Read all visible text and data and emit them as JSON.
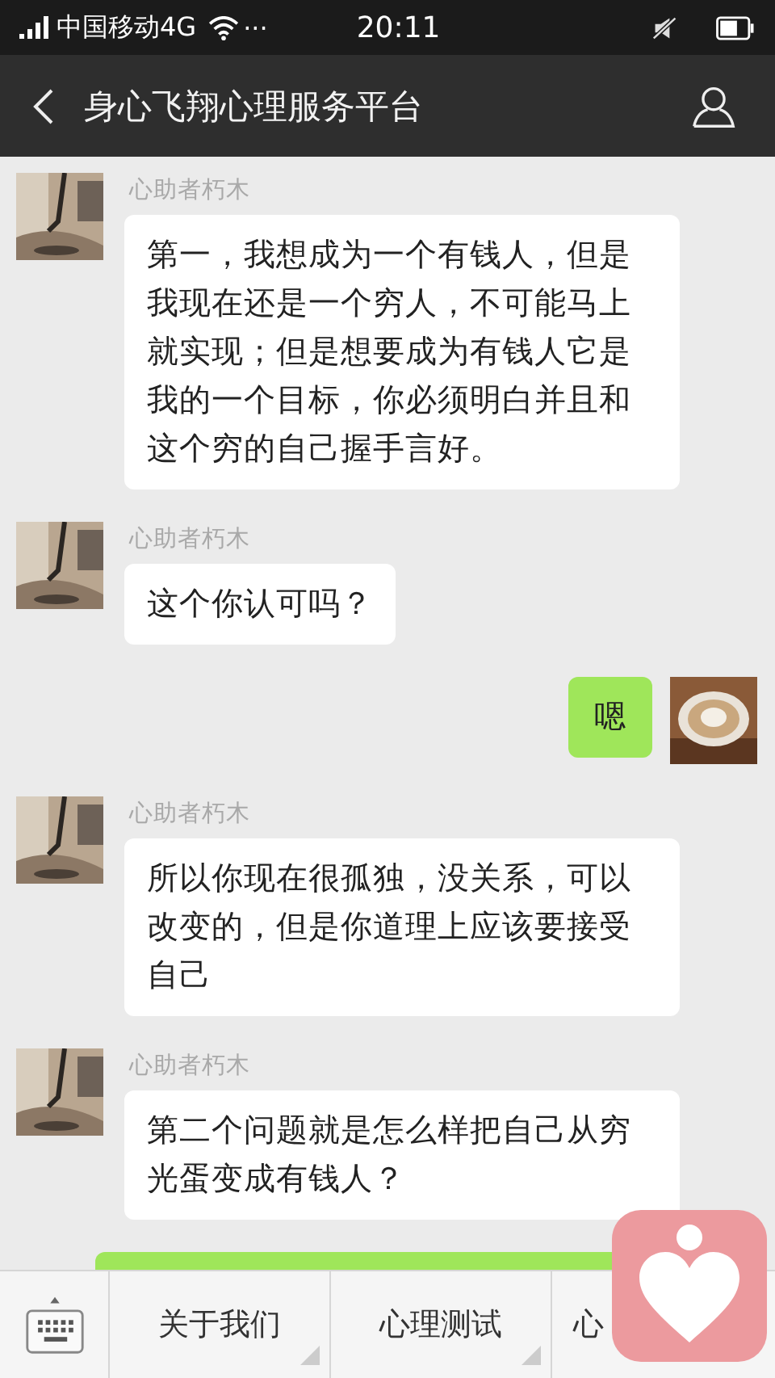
{
  "status_bar": {
    "carrier": "中国移动4G",
    "more": "···",
    "time": "20:11"
  },
  "nav": {
    "title": "身心飞翔心理服务平台"
  },
  "messages": [
    {
      "kind": "received",
      "sender": "心助者朽木",
      "text": "第一，我想成为一个有钱人，但是我现在还是一个穷人，不可能马上就实现；但是想要成为有钱人它是我的一个目标，你必须明白并且和这个穷的自己握手言好。"
    },
    {
      "kind": "received",
      "sender": "心助者朽木",
      "text": "这个你认可吗？"
    },
    {
      "kind": "sent",
      "text": "嗯"
    },
    {
      "kind": "received",
      "sender": "心助者朽木",
      "text": "所以你现在很孤独，没关系，可以改变的，但是你道理上应该要接受自己"
    },
    {
      "kind": "received",
      "sender": "心助者朽木",
      "text": "第二个问题就是怎么样把自己从穷光蛋变成有钱人？"
    }
  ],
  "menu": [
    "关于我们",
    "心理测试",
    "心"
  ]
}
